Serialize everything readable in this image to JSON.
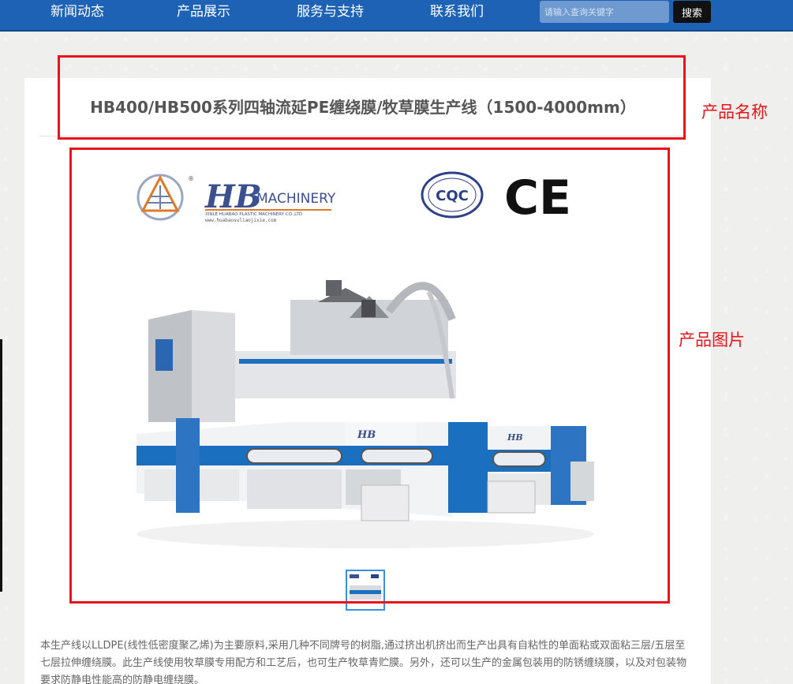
{
  "nav": {
    "items": [
      "新闻动态",
      "产品展示",
      "服务与支持",
      "联系我们"
    ],
    "search_placeholder": "请输入查询关键字",
    "search_button": "搜索"
  },
  "product": {
    "title": "HB400/HB500系列四轴流延PE缠绕膜/牧草膜生产线（1500-4000mm）",
    "description": "本生产线以LLDPE(线性低密度聚乙烯)为主要原料,采用几种不同牌号的树脂,通过挤出机挤出而生产出具有自粘性的单面粘或双面粘三层/五层至七层拉伸缠绕膜。此生产线使用牧草膜专用配方和工艺后，也可生产牧草青贮膜。另外，还可以生产的金属包装用的防锈缠绕膜，以及对包装物要求防静电性能高的防静电缠绕膜。"
  },
  "image": {
    "brand_logo_text": "MACHINERY",
    "brand_sub": "XINLE HUABAO PLASTIC MACHINERY CO.,LTD",
    "brand_url": "www.huabaosuliaojixie.com",
    "cert_cqc": "CQC",
    "cert_ce": "CE"
  },
  "annotations": {
    "name_label": "产品名称",
    "image_label": "产品图片"
  },
  "colors": {
    "nav_bg": "#1e62b5",
    "annotation": "#e8141c",
    "machine_blue": "#1b6fbf"
  }
}
